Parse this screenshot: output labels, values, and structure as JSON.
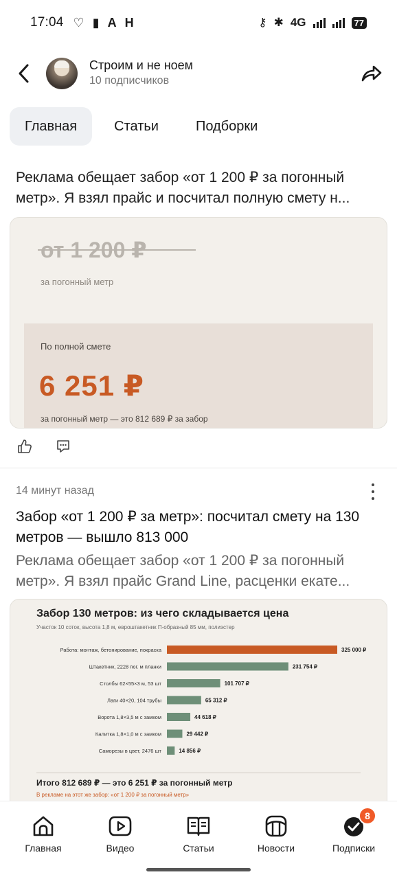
{
  "status_bar": {
    "time": "17:04",
    "network": "4G",
    "battery": "77"
  },
  "header": {
    "channel_name": "Строим и не ноем",
    "subscribers": "10 подписчиков"
  },
  "tabs": [
    {
      "label": "Главная",
      "active": true
    },
    {
      "label": "Статьи",
      "active": false
    },
    {
      "label": "Подборки",
      "active": false
    }
  ],
  "post1": {
    "text": "Реклама обещает забор «от 1 200 ₽ за погонный метр». Я взял прайс и посчитал полную смету н...",
    "card": {
      "old_price": "от 1 200 ₽",
      "old_price_unit": "за погонный метр",
      "full_label": "По полной смете",
      "full_price": "6 251 ₽",
      "full_note": "за погонный метр — это 812 689 ₽ за забор"
    }
  },
  "post2": {
    "time_ago": "14 минут назад",
    "title": "Забор «от 1 200 ₽ за метр»: посчитал смету на 130 метров — вышло 813 000",
    "text": "Реклама обещает забор «от 1 200 ₽ за погонный метр». Я взял прайс Grand Line, расценки екате..."
  },
  "chart_data": {
    "type": "bar",
    "orientation": "horizontal",
    "title": "Забор 130 метров: из чего складывается цена",
    "subtitle": "Участок 10 соток, высота 1,8 м, евроштакетник П-образный 85 мм, полиэстер",
    "categories": [
      "Работа: монтаж, бетонирование, покраска",
      "Штакетник, 2228 пог. м планки",
      "Столбы 62×55×3 м, 53 шт",
      "Лаги 40×20, 104 трубы",
      "Ворота 1,8×3,5 м с замком",
      "Калитка 1,8×1,0 м с замком",
      "Саморезы в цвет, 2476 шт"
    ],
    "values": [
      325000,
      231754,
      101707,
      65312,
      44618,
      29442,
      14856
    ],
    "value_labels": [
      "325 000 ₽",
      "231 754 ₽",
      "101 707 ₽",
      "65 312 ₽",
      "44 618 ₽",
      "29 442 ₽",
      "14 856 ₽"
    ],
    "colors": [
      "#c85a24",
      "#6e8f78",
      "#6e8f78",
      "#6e8f78",
      "#6e8f78",
      "#6e8f78",
      "#6e8f78"
    ],
    "xlim": [
      0,
      325000
    ],
    "total": "Итого 812 689 ₽  —  это 6 251 ₽ за погонный метр",
    "ad_note": "В рекламе на этот же забор: «от 1 200 ₽ за погонный метр»"
  },
  "bottom_nav": [
    {
      "label": "Главная",
      "icon": "home-icon"
    },
    {
      "label": "Видео",
      "icon": "video-icon"
    },
    {
      "label": "Статьи",
      "icon": "articles-icon"
    },
    {
      "label": "Новости",
      "icon": "news-icon"
    },
    {
      "label": "Подписки",
      "icon": "subscriptions-icon",
      "badge": "8"
    }
  ]
}
